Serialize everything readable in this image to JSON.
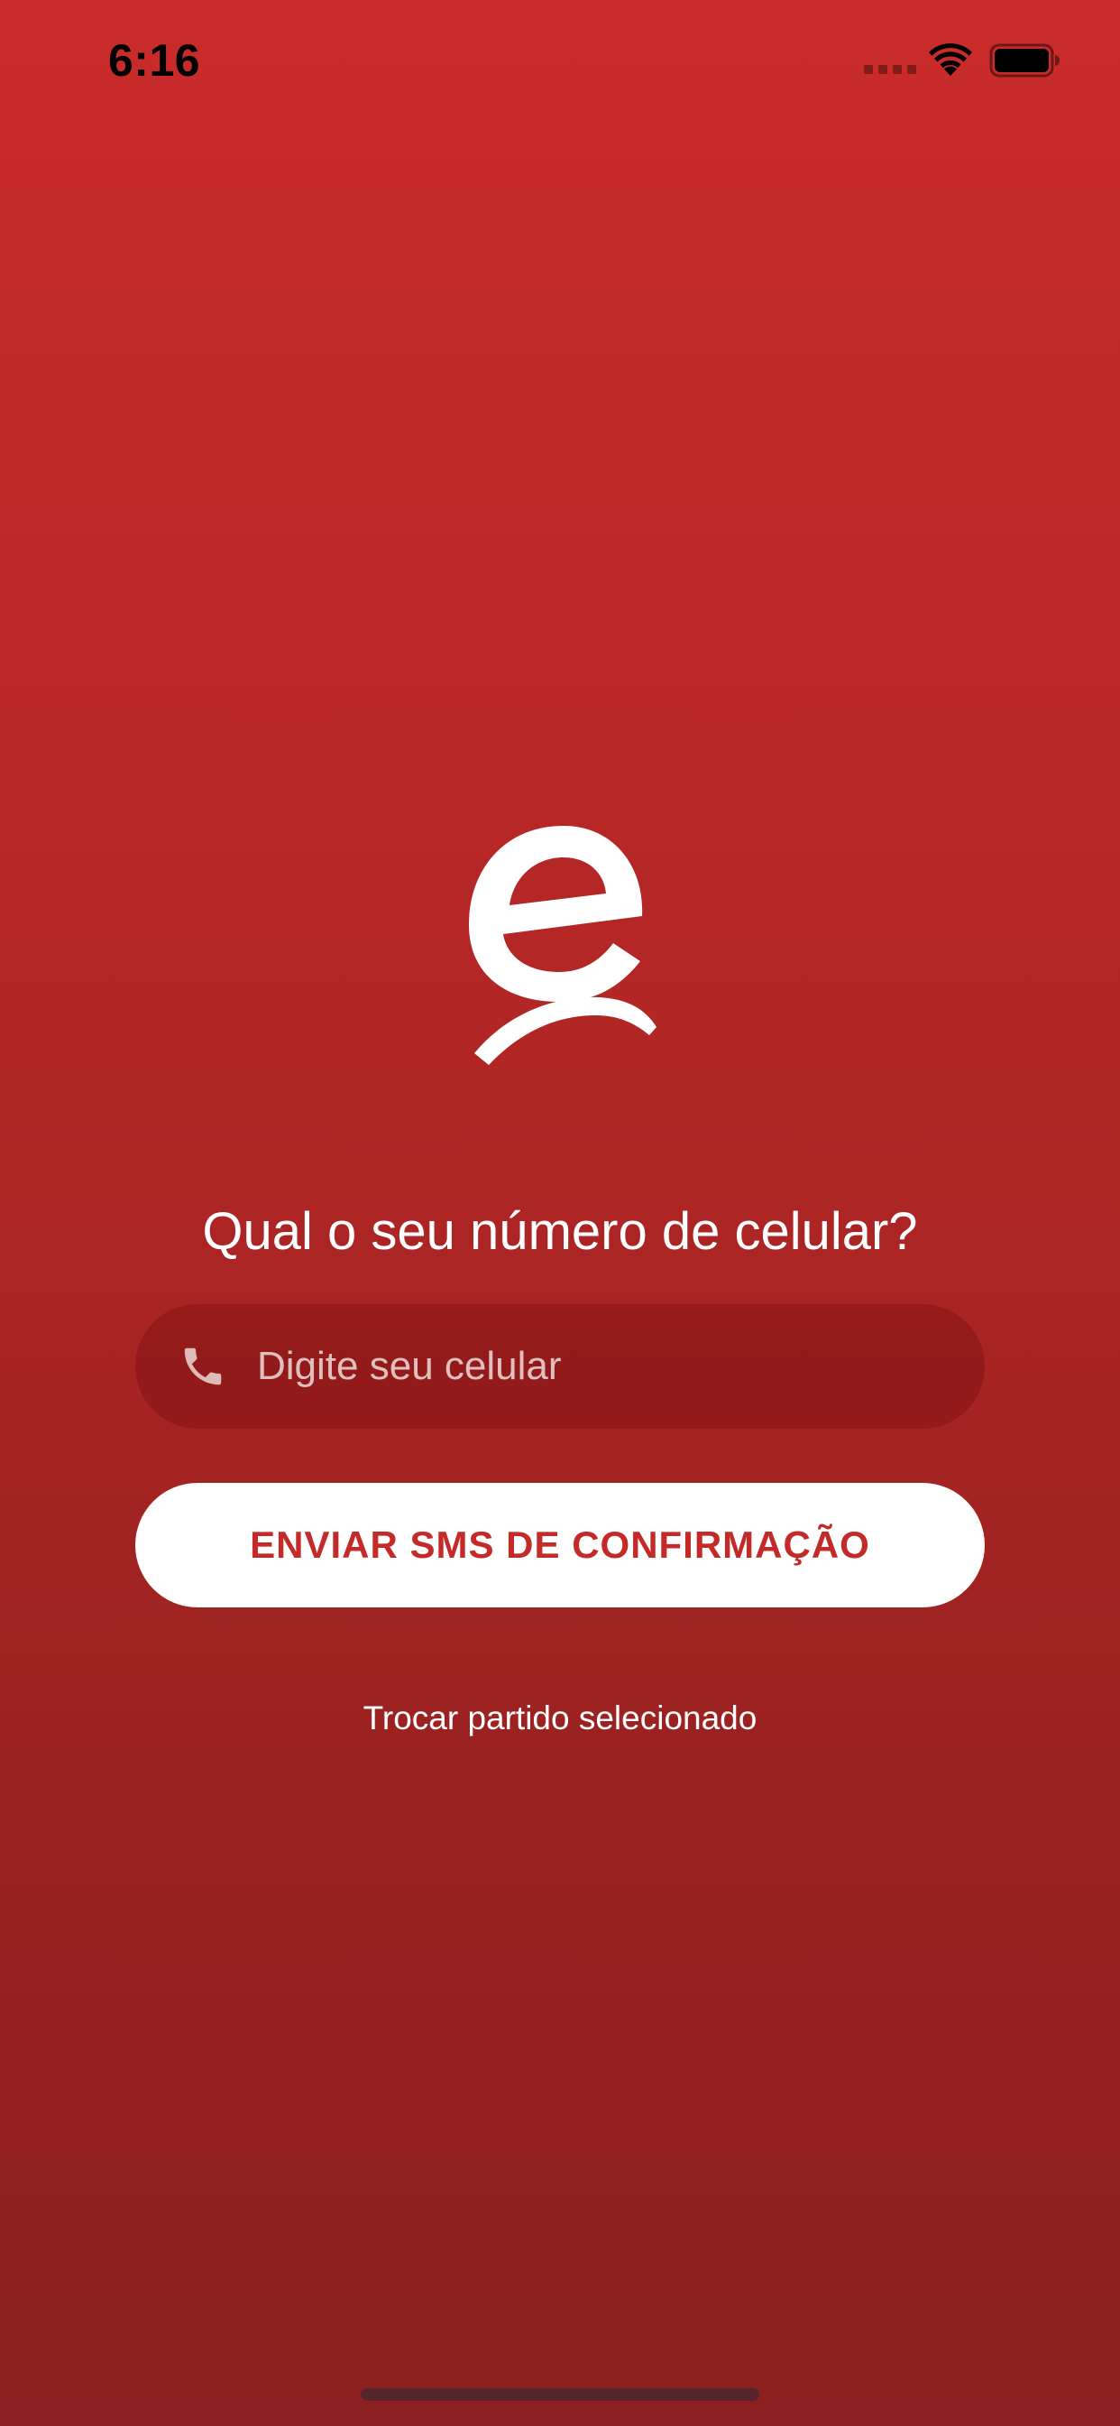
{
  "status_bar": {
    "time": "6:16",
    "icons": [
      "cellular-signal-icon",
      "wifi-icon",
      "battery-icon"
    ]
  },
  "logo": {
    "icon": "app-logo-icon"
  },
  "login": {
    "question": "Qual o seu número de celular?",
    "phone_field": {
      "icon": "phone-icon",
      "placeholder": "Digite seu celular",
      "value": ""
    },
    "send_button_label": "ENVIAR SMS DE CONFIRMAÇÃO",
    "switch_party_label": "Trocar partido selecionado"
  },
  "colors": {
    "background_top": "#c92b2a",
    "background_bottom": "#8c1f1f",
    "button_background": "#ffffff",
    "button_text": "#c42a28",
    "text": "#ffffff"
  }
}
